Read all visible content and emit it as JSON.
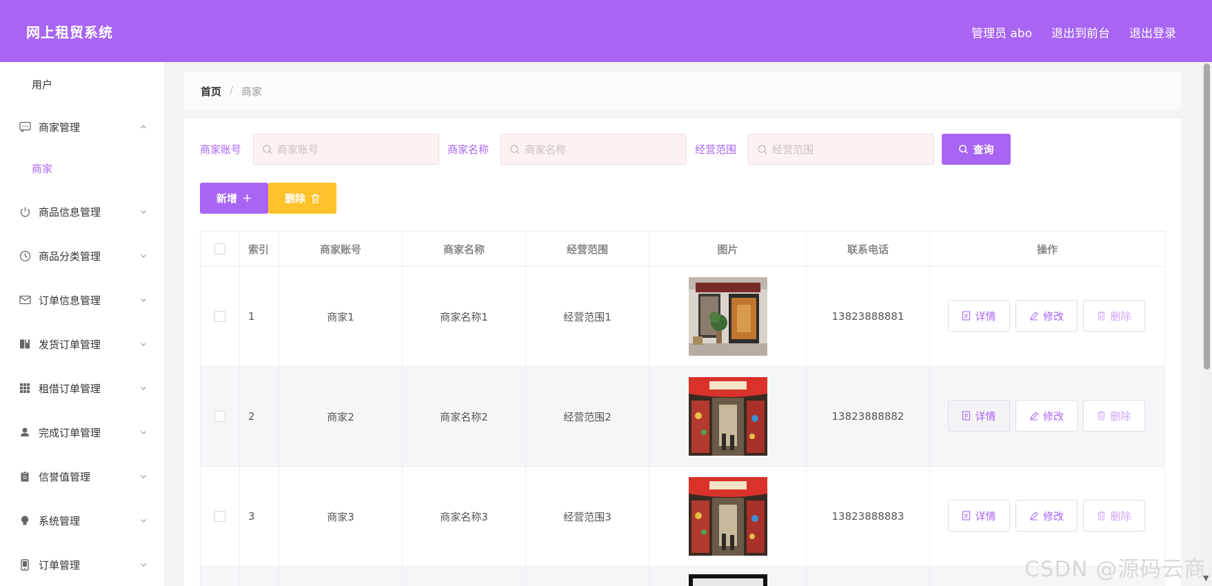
{
  "app": {
    "title": "网上租贸系统",
    "admin_label": "管理员 abo",
    "front_label": "退出到前台",
    "logout_label": "退出登录",
    "accent": "#a865f3",
    "warning": "#fdc22a"
  },
  "sidebar": {
    "top_item": "用户",
    "items": [
      {
        "label": "商家管理",
        "icon": "message-icon",
        "expanded": true
      },
      {
        "label": "商品信息管理",
        "icon": "power-icon"
      },
      {
        "label": "商品分类管理",
        "icon": "clock-icon"
      },
      {
        "label": "订单信息管理",
        "icon": "mail-icon"
      },
      {
        "label": "发货订单管理",
        "icon": "book-icon"
      },
      {
        "label": "租借订单管理",
        "icon": "grid-icon"
      },
      {
        "label": "完成订单管理",
        "icon": "user-icon"
      },
      {
        "label": "信誉值管理",
        "icon": "clipboard-icon"
      },
      {
        "label": "系统管理",
        "icon": "bulb-icon"
      },
      {
        "label": "订单管理",
        "icon": "tablet-icon"
      }
    ],
    "sub_item": "商家"
  },
  "breadcrumb": {
    "home": "首页",
    "sep": "/",
    "current": "商家"
  },
  "filters": {
    "account_label": "商家账号",
    "account_placeholder": "商家账号",
    "name_label": "商家名称",
    "name_placeholder": "商家名称",
    "scope_label": "经营范围",
    "scope_placeholder": "经营范围",
    "search_button": "查询"
  },
  "actions": {
    "add": "新增",
    "delete": "删除"
  },
  "table": {
    "headers": [
      "索引",
      "商家账号",
      "商家名称",
      "经营范围",
      "图片",
      "联系电话",
      "操作"
    ],
    "rows": [
      {
        "index": "1",
        "account": "商家1",
        "name": "商家名称1",
        "scope": "经营范围1",
        "image": "storefront-photo",
        "phone": "13823888881"
      },
      {
        "index": "2",
        "account": "商家2",
        "name": "商家名称2",
        "scope": "经营范围2",
        "image": "shop-interior-photo",
        "phone": "13823888882"
      },
      {
        "index": "3",
        "account": "商家3",
        "name": "商家名称3",
        "scope": "经营范围3",
        "image": "shop-interior-photo",
        "phone": "13823888883"
      }
    ],
    "ops": {
      "detail": "详情",
      "edit": "修改",
      "delete": "删除"
    }
  },
  "watermark": "CSDN @源码云商"
}
